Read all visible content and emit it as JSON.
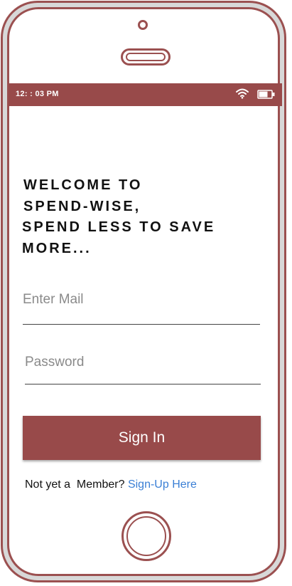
{
  "status_bar": {
    "time": "12: : 03 PM",
    "wifi_icon": "wifi-icon",
    "battery_icon": "battery-icon",
    "color": "#984a4a"
  },
  "welcome": {
    "line1": "WELCOME TO",
    "line2": "SPEND-WISE,",
    "line3": "SPEND LESS TO SAVE",
    "line4": "MORE..."
  },
  "form": {
    "email_placeholder": "Enter Mail",
    "email_value": "",
    "password_placeholder": "Password",
    "password_value": "",
    "signin_label": "Sign In"
  },
  "footer": {
    "prompt": "Not yet a  Member? ",
    "signup_link": "Sign-Up Here"
  },
  "colors": {
    "accent": "#984a4a",
    "link": "#3a7fd5"
  }
}
